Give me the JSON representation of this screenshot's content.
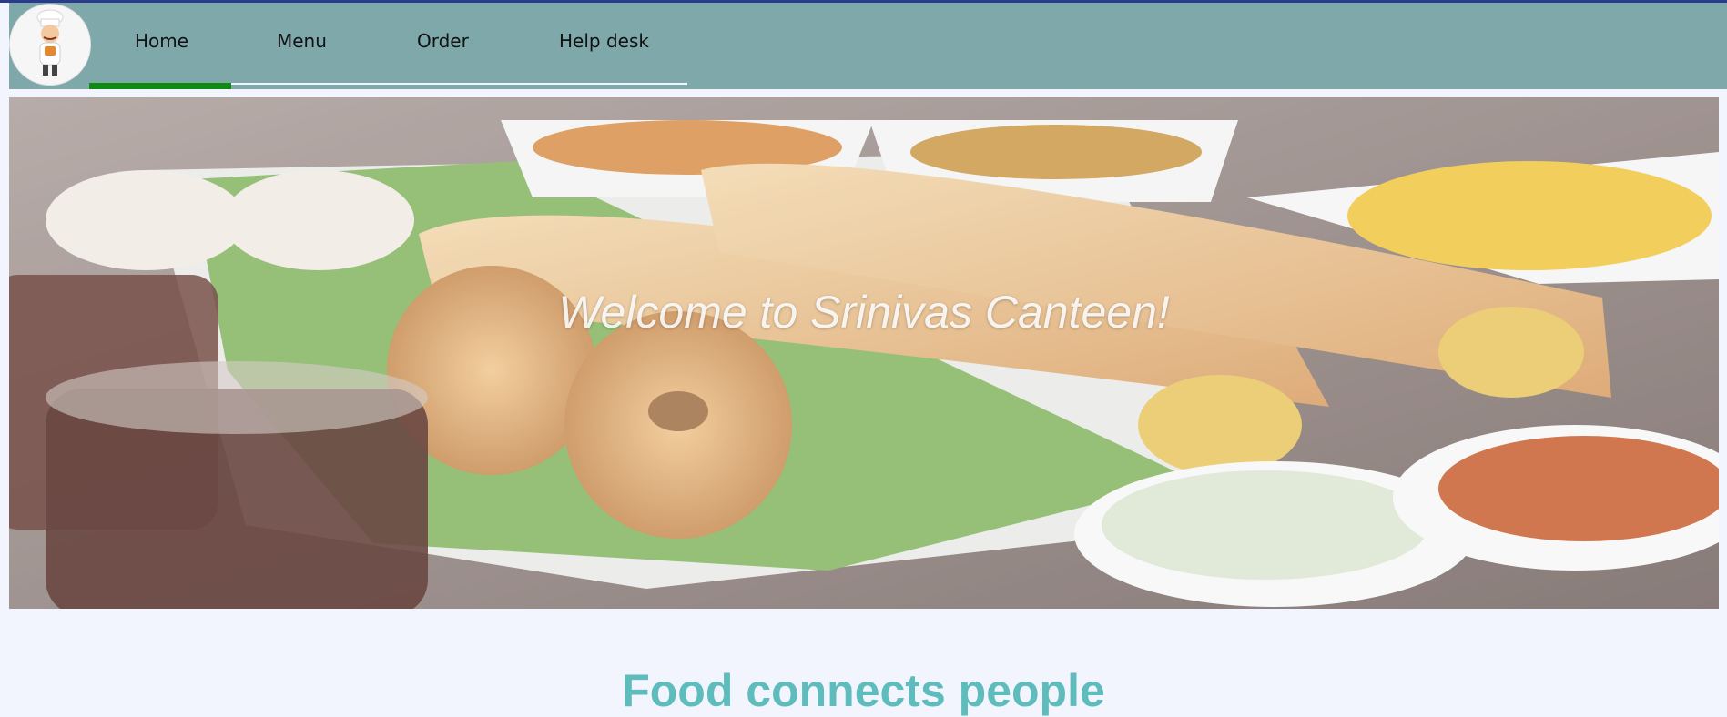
{
  "nav": {
    "logo_alt": "chef-logo",
    "items": [
      {
        "label": "Home",
        "active": true
      },
      {
        "label": "Menu",
        "active": false
      },
      {
        "label": "Order",
        "active": false
      },
      {
        "label": "Help desk",
        "active": false
      }
    ]
  },
  "hero": {
    "title": "Welcome to Srinivas Canteen!"
  },
  "section": {
    "title": "Food connects people"
  },
  "colors": {
    "navbar": "#7fa8aa",
    "active_underline": "#0f8a12",
    "page_background": "#f2f5fd",
    "section_title": "#5ebcbc"
  }
}
